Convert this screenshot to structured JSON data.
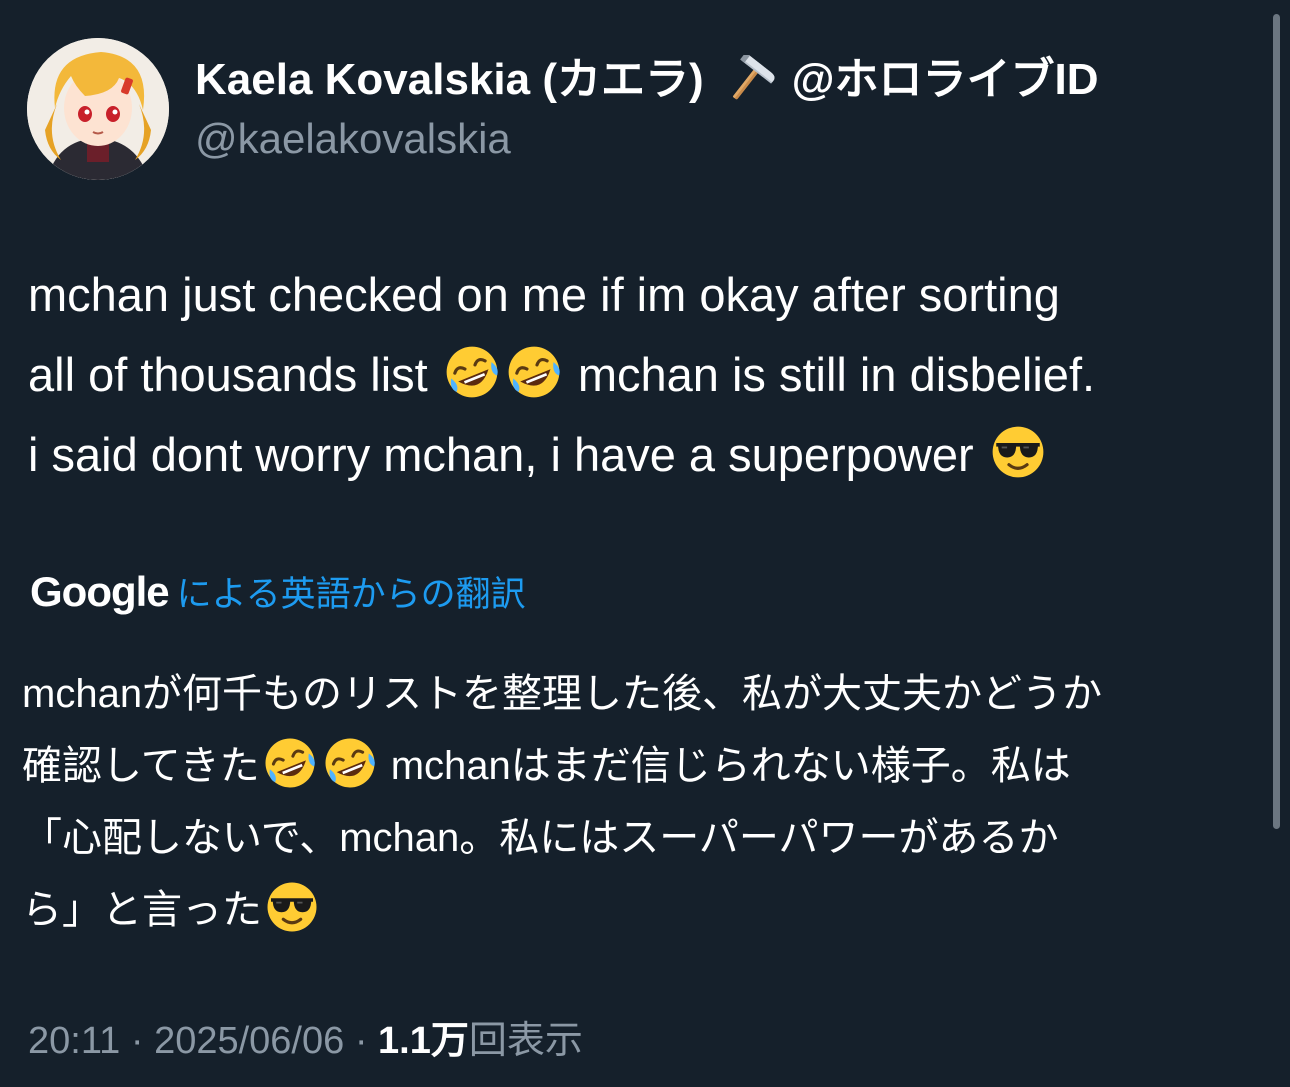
{
  "author": {
    "display_name": "Kaela Kovalskia (カエラ)",
    "name_suffix": "@ホロライブID",
    "handle": "@kaelakovalskia",
    "avatar_icon": "avatar-girl-blonde-icon",
    "name_emoji_icon": "hammer-icon"
  },
  "tweet": {
    "line1": "mchan just checked on me if im okay after sorting",
    "line2_pre": "all of thousands list",
    "line2_post": "mchan is still in disbelief.",
    "line3": "i said dont worry mchan, i have a superpower"
  },
  "translation": {
    "brand": "Google",
    "label": "による英語からの翻訳",
    "line1": "mchanが何千ものリストを整理した後、私が大丈夫かどうか",
    "line2_pre": "確認してきた",
    "line2_post": "mchanはまだ信じられない様子。私は",
    "line3": "「心配しないで、mchan。私にはスーパーパワーがあるか",
    "line4": "ら」と言った"
  },
  "meta": {
    "time": "20:11",
    "sep1": "·",
    "date": "2025/06/06",
    "sep2": "·",
    "views_count": "1.1万",
    "views_label": "回表示"
  },
  "colors": {
    "background": "#15202b",
    "text_primary": "#ffffff",
    "text_secondary": "#8b98a5",
    "link": "#1d9bf0"
  }
}
